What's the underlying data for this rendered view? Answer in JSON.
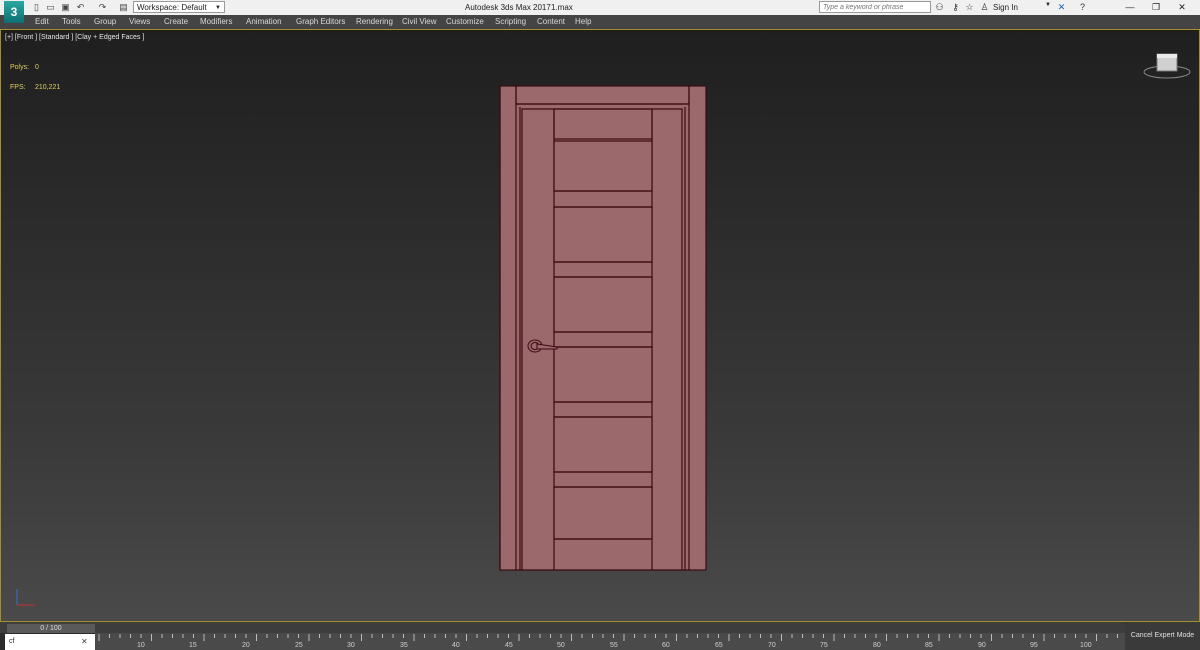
{
  "app": {
    "logo": "3",
    "title": "Autodesk 3ds Max 2017",
    "file": "1.max"
  },
  "quick_access": {
    "workspace": "Workspace: Default"
  },
  "search": {
    "placeholder": "Type a keyword or phrase"
  },
  "account": {
    "sign_in": "Sign In"
  },
  "menu": [
    "Edit",
    "Tools",
    "Group",
    "Views",
    "Create",
    "Modifiers",
    "Animation",
    "Graph Editors",
    "Rendering",
    "Civil View",
    "Customize",
    "Scripting",
    "Content",
    "Help"
  ],
  "viewport": {
    "label": "[+] [Front ] [Standard ] [Clay + Edged Faces ]",
    "polys_label": "Polys:",
    "polys_value": "0",
    "fps_label": "FPS:",
    "fps_value": "210,221"
  },
  "timeline": {
    "frame": "0 / 100",
    "ticks": [
      "10",
      "15",
      "20",
      "25",
      "30",
      "35",
      "40",
      "45",
      "50",
      "55",
      "60",
      "65",
      "70",
      "75",
      "80",
      "85",
      "90",
      "95",
      "100"
    ]
  },
  "listener": {
    "text": "cf"
  },
  "status": {
    "cancel_expert": "Cancel Expert Mode"
  },
  "colors": {
    "door_fill": "#9b686c",
    "door_edge": "#3a0a10"
  }
}
